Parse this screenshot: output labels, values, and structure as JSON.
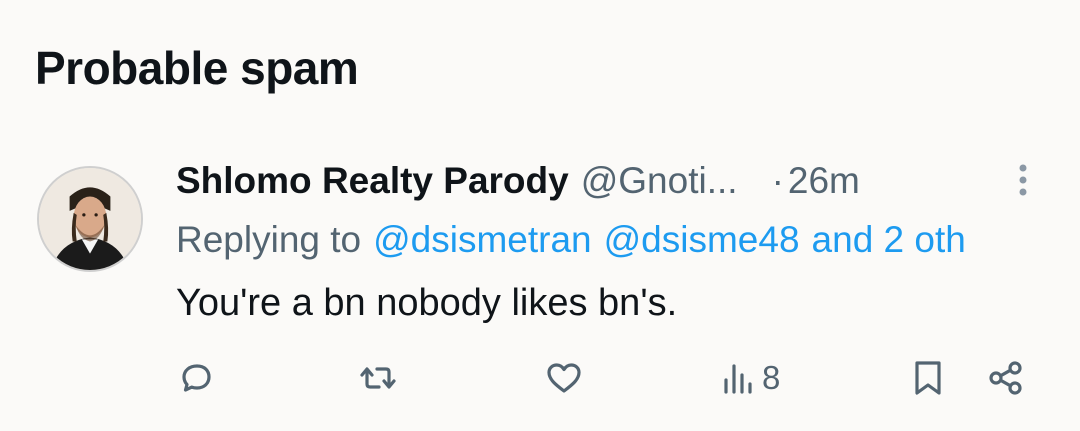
{
  "section": {
    "title": "Probable spam"
  },
  "tweet": {
    "author_name": "Shlomo Realty Parody",
    "handle": "@Gnoti...",
    "dot": "·",
    "time": "26m",
    "replying_label": "Replying to",
    "mentions": [
      "@dsismetran",
      "@dsisme48"
    ],
    "and_others": "and 2 oth",
    "text": "You're a bn nobody likes bn's."
  },
  "actions": {
    "reply_icon": "speech-bubble-icon",
    "retweet_icon": "retweet-arrows-icon",
    "like_icon": "heart-icon",
    "views_icon": "bar-chart-icon",
    "views_count": "8",
    "bookmark_icon": "bookmark-icon",
    "share_icon": "share-nodes-icon"
  },
  "colors": {
    "background": "#fbfaf8",
    "text": "#0f1419",
    "secondary": "#536471",
    "link": "#1d9bf0"
  }
}
